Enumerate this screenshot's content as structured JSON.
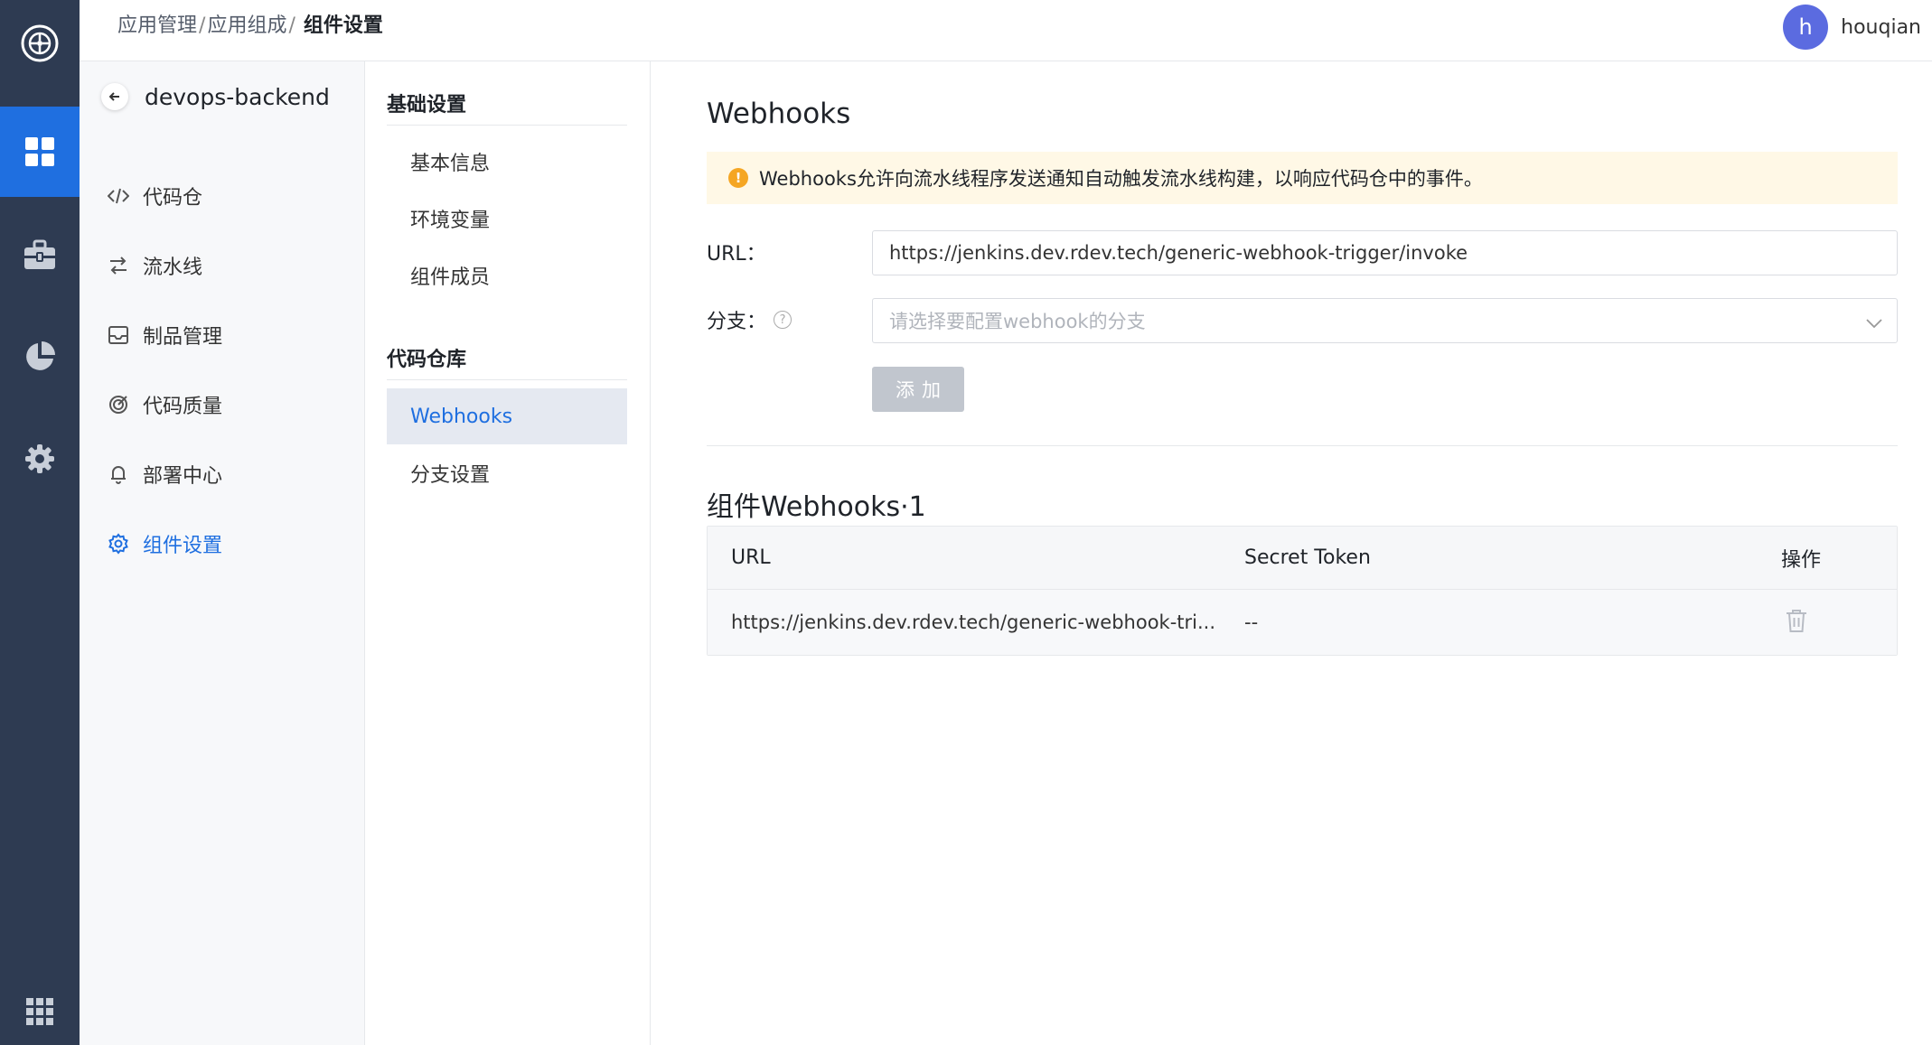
{
  "breadcrumb": {
    "items": [
      "应用管理",
      "应用组成"
    ],
    "separator": "/",
    "current": "组件设置"
  },
  "user": {
    "avatar_letter": "h",
    "name": "houqian"
  },
  "rail": {
    "icons": [
      "logo-icon",
      "apps-grid-icon",
      "toolbox-icon",
      "pie-chart-icon",
      "settings-icon",
      "app-launcher-icon"
    ],
    "active": "apps-grid-icon",
    "colors": {
      "background": "#2e3b52",
      "active": "#1f6fe0"
    }
  },
  "component": {
    "name": "devops-backend",
    "back_icon": "arrow-left-icon"
  },
  "component_menu": [
    {
      "label": "代码仓",
      "icon": "code-icon"
    },
    {
      "label": "流水线",
      "icon": "pipeline-icon"
    },
    {
      "label": "制品管理",
      "icon": "inbox-icon"
    },
    {
      "label": "代码质量",
      "icon": "target-icon"
    },
    {
      "label": "部署中心",
      "icon": "bell-icon"
    },
    {
      "label": "组件设置",
      "icon": "gear-icon",
      "active": true
    }
  ],
  "settings_menu": {
    "groups": [
      {
        "title": "基础设置",
        "items": [
          "基本信息",
          "环境变量",
          "组件成员"
        ]
      },
      {
        "title": "代码仓库",
        "items": [
          "Webhooks",
          "分支设置"
        ]
      }
    ],
    "active": "Webhooks"
  },
  "main": {
    "title": "Webhooks",
    "alert": "Webhooks允许向流水线程序发送通知自动触发流水线构建，以响应代码仓中的事件。",
    "url_label": "URL：",
    "url_value": "https://jenkins.dev.rdev.tech/generic-webhook-trigger/invoke",
    "branch_label": "分支：",
    "branch_placeholder": "请选择要配置webhook的分支",
    "add_button": "添加",
    "list_title": "组件Webhooks·1",
    "table": {
      "columns": [
        "URL",
        "Secret Token",
        "操作"
      ],
      "rows": [
        {
          "url": "https://jenkins.dev.rdev.tech/generic-webhook-tri...",
          "token": "--",
          "action_icon": "trash-icon"
        }
      ]
    }
  },
  "colors": {
    "accent": "#1f6fe0",
    "alert_bg": "#fff8e6",
    "alert_icon": "#f5a623",
    "button_disabled": "#c1c6ce"
  }
}
